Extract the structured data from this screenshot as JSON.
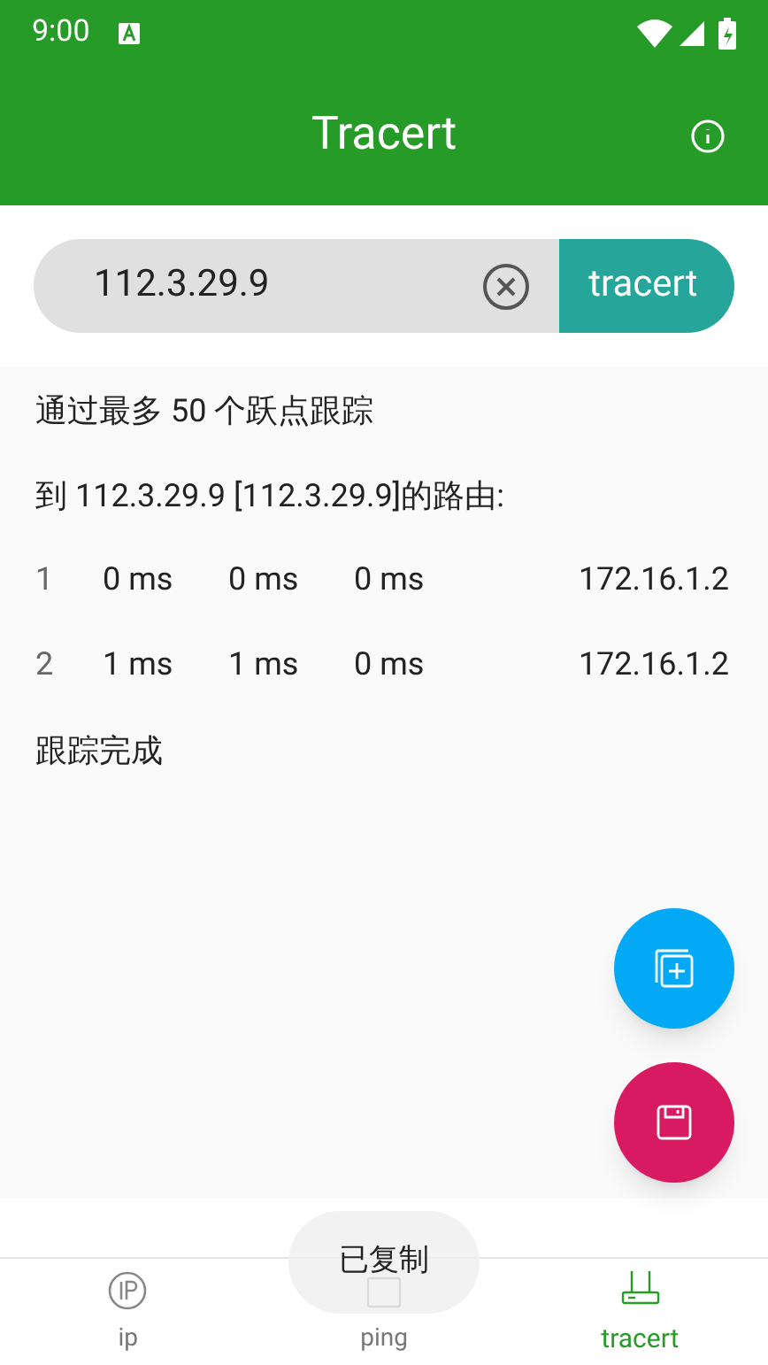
{
  "status_bar": {
    "time": "9:00"
  },
  "app_bar": {
    "title": "Tracert"
  },
  "search": {
    "value": "112.3.29.9",
    "button": "tracert"
  },
  "output": {
    "header": "通过最多 50 个跃点跟踪",
    "route": "到  112.3.29.9  [112.3.29.9]的路由:",
    "hops": [
      {
        "hop": "1",
        "times": [
          "0 ms",
          "0 ms",
          "0 ms"
        ],
        "address": "172.16.1.2"
      },
      {
        "hop": "2",
        "times": [
          "1 ms",
          "1 ms",
          "0 ms"
        ],
        "address": "172.16.1.2"
      }
    ],
    "footer": "跟踪完成"
  },
  "toast": "已复制",
  "bottom_nav": [
    {
      "label": "ip",
      "kind": "ip",
      "selected": false
    },
    {
      "label": "ping",
      "kind": "ping",
      "selected": false
    },
    {
      "label": "tracert",
      "kind": "tracert",
      "selected": true
    }
  ]
}
